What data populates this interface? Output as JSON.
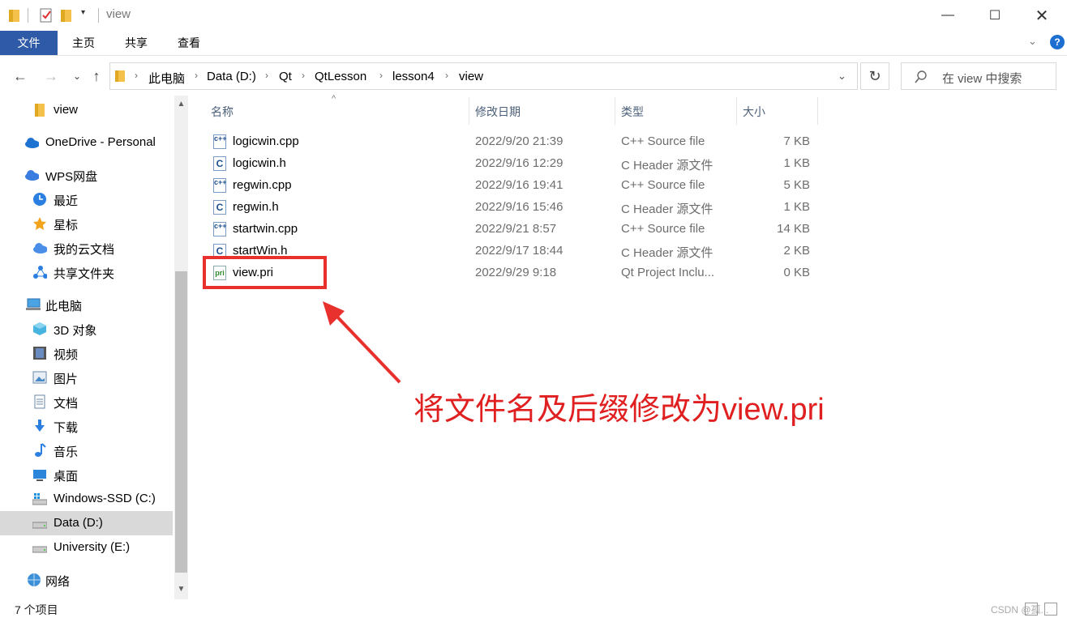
{
  "window": {
    "title": "view"
  },
  "ribbon": {
    "tabs": [
      "文件",
      "主页",
      "共享",
      "查看"
    ]
  },
  "address": {
    "crumbs": [
      "此电脑",
      "Data (D:)",
      "Qt",
      "QtLesson",
      "lesson4",
      "view"
    ]
  },
  "search": {
    "placeholder": "在 view 中搜索"
  },
  "sidebar": {
    "items": [
      {
        "label": "view",
        "icon": "folder-icon"
      },
      {
        "label": "OneDrive - Personal",
        "icon": "cloud-icon"
      },
      {
        "label": "WPS网盘",
        "icon": "wps-cloud-icon"
      },
      {
        "label": "最近",
        "icon": "clock-icon"
      },
      {
        "label": "星标",
        "icon": "star-icon"
      },
      {
        "label": "我的云文档",
        "icon": "cloud-doc-icon"
      },
      {
        "label": "共享文件夹",
        "icon": "share-folder-icon"
      },
      {
        "label": "此电脑",
        "icon": "computer-icon"
      },
      {
        "label": "3D 对象",
        "icon": "3d-objects-icon"
      },
      {
        "label": "视频",
        "icon": "video-icon"
      },
      {
        "label": "图片",
        "icon": "picture-icon"
      },
      {
        "label": "文档",
        "icon": "document-icon"
      },
      {
        "label": "下载",
        "icon": "download-icon"
      },
      {
        "label": "音乐",
        "icon": "music-icon"
      },
      {
        "label": "桌面",
        "icon": "desktop-icon"
      },
      {
        "label": "Windows-SSD (C:)",
        "icon": "drive-c-icon"
      },
      {
        "label": "Data (D:)",
        "icon": "drive-d-icon"
      },
      {
        "label": "University (E:)",
        "icon": "drive-e-icon"
      },
      {
        "label": "网络",
        "icon": "network-icon"
      }
    ]
  },
  "columns": {
    "name": "名称",
    "date": "修改日期",
    "type": "类型",
    "size": "大小"
  },
  "files": [
    {
      "name": "logicwin.cpp",
      "date": "2022/9/20 21:39",
      "type": "C++ Source file",
      "size": "7 KB",
      "icon": "cpp-file-icon"
    },
    {
      "name": "logicwin.h",
      "date": "2022/9/16 12:29",
      "type": "C Header 源文件",
      "size": "1 KB",
      "icon": "header-file-icon"
    },
    {
      "name": "regwin.cpp",
      "date": "2022/9/16 19:41",
      "type": "C++ Source file",
      "size": "5 KB",
      "icon": "cpp-file-icon"
    },
    {
      "name": "regwin.h",
      "date": "2022/9/16 15:46",
      "type": "C Header 源文件",
      "size": "1 KB",
      "icon": "header-file-icon"
    },
    {
      "name": "startwin.cpp",
      "date": "2022/9/21 8:57",
      "type": "C++ Source file",
      "size": "14 KB",
      "icon": "cpp-file-icon"
    },
    {
      "name": "startWin.h",
      "date": "2022/9/17 18:44",
      "type": "C Header 源文件",
      "size": "2 KB",
      "icon": "header-file-icon"
    },
    {
      "name": "view.pri",
      "date": "2022/9/29 9:18",
      "type": "Qt Project Inclu...",
      "size": "0 KB",
      "icon": "pri-file-icon"
    }
  ],
  "annotation": {
    "text": "将文件名及后缀修改为view.pri"
  },
  "status": {
    "count": "7 个项目"
  },
  "watermark": "CSDN @孤...",
  "colors": {
    "accent": "#2e5aa8",
    "annotation": "#e8302d",
    "selected": "#d9d9d9"
  }
}
